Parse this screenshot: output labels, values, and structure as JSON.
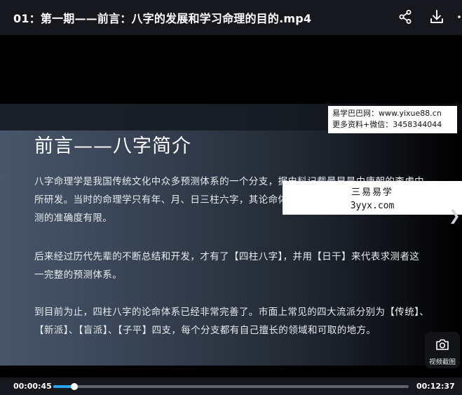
{
  "header": {
    "title": "01：第一期——前言：八字的发展和学习命理的目的.mp4",
    "icons": [
      "share-icon",
      "download-icon",
      "more-icon"
    ]
  },
  "slide": {
    "heading": "前言——八字简介",
    "paragraphs": [
      [
        "八字命理学是我国传统文化中众多预测体系的一个分支，据史料记载最早是由唐朝的李虚中",
        "所研发。当时的命理学只有年、月、日三柱六字，其论命体",
        "测的准确度有限。"
      ],
      [
        "后来经过历代先辈的不断总结和开发，才有了【四柱八字】，并用【日干】来代表求测者这",
        "一完整的预测体系。"
      ],
      [
        "到目前为止，四柱八字的论命体系已经非常完善了。市面上常见的四大流派分别为【传统】、",
        "【新派】、【盲派】、【子平】四支，每个分支都有自己擅长的领域和可取的地方。"
      ]
    ]
  },
  "watermarks": {
    "line1": "易学巴巴网：www.yixue88.cn",
    "line2": "更多资料+微信：3458344044",
    "box_title": "三易易学",
    "box_url": "3yyx.com"
  },
  "capture": {
    "label": "视频截图",
    "icon": "camera-icon"
  },
  "player": {
    "current_time": "00:00:45",
    "duration": "00:12:37",
    "progress": 0.059,
    "accent": "#2aa6f0"
  }
}
